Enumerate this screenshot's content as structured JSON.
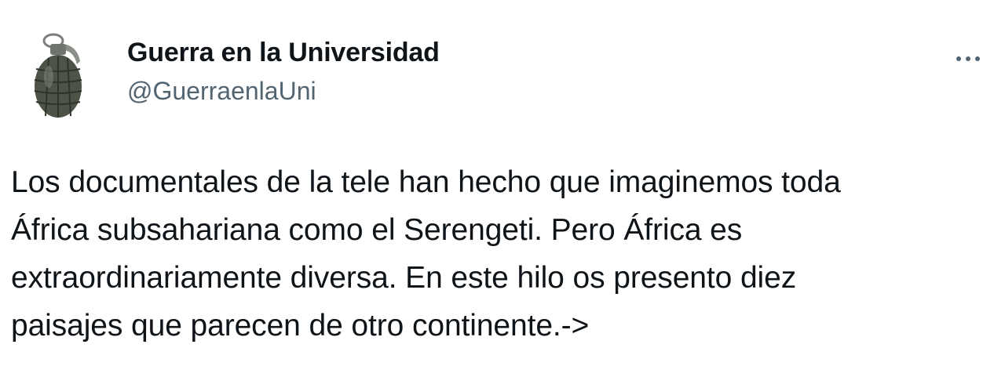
{
  "author": {
    "display_name": "Guerra en la Universidad",
    "handle": "@GuerraenlaUni",
    "avatar_icon": "hand-grenade-icon"
  },
  "actions": {
    "more_icon": "more-options-icon"
  },
  "tweet": {
    "text": "Los documentales de la tele han hecho que imaginemos toda\nÁfrica subsahariana como el Serengeti. Pero África es\nextraordinariamente diversa. En este hilo os presento diez\npaisajes que parecen de otro continente.->"
  },
  "colors": {
    "text": "#0f1419",
    "secondary": "#536471",
    "background": "#ffffff"
  }
}
